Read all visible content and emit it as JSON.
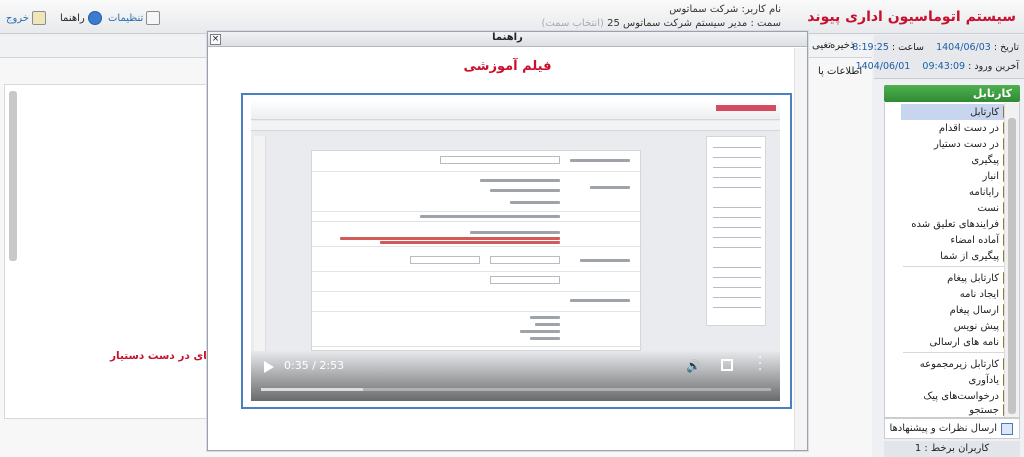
{
  "header": {
    "app_title": "سیستم اتوماسیون اداری پیوند",
    "user_name": "نام کاربر: شرکت سماتوس",
    "user_role": "سمت : مدیر سیستم شرکت سماتوس 25",
    "user_role_hint": "(انتخاب سمت)",
    "settings_label": "تنظیمات",
    "help_label": "راهنما",
    "exit_label": "خروج"
  },
  "dates": {
    "date_label": "تاریخ :",
    "date_value": "1404/06/03",
    "time_label": "ساعت :",
    "time_value": "8:19:25",
    "last_login_label": "آخرین ورود :",
    "last_login_time": "09:43:09",
    "last_login_date": "1404/06/01"
  },
  "toolbar": {
    "save_label": "ذخیره",
    "change_label": "تغیی"
  },
  "main": {
    "tab_info": "اطلاعات پا",
    "red_text": "د نامه های در دست دستیار"
  },
  "sidebar": {
    "header": "کارتابل",
    "items": [
      {
        "label": "کارتابل",
        "active": true
      },
      {
        "label": "در دست اقدام"
      },
      {
        "label": "در دست دستیار"
      },
      {
        "label": "پیگیری"
      },
      {
        "label": "انبار"
      },
      {
        "label": "رایانامه"
      },
      {
        "label": "نست"
      },
      {
        "label": "فرایندهای تعلیق شده"
      },
      {
        "label": "آماده امضاء"
      },
      {
        "label": "پیگیری از شما"
      },
      {
        "label": "کارتابل پیغام"
      },
      {
        "label": "ایجاد نامه"
      },
      {
        "label": "ارسال پیغام"
      },
      {
        "label": "پیش نویس"
      },
      {
        "label": "نامه های ارسالی"
      },
      {
        "label": "کارتابل زیرمجموعه"
      },
      {
        "label": "یادآوری"
      },
      {
        "label": "درخواست‌های پیک"
      },
      {
        "label": "جستجو"
      }
    ],
    "feedback_label": "ارسال نظرات و پیشنهادها",
    "online_label": "کاربران برخط : 1"
  },
  "modal": {
    "title": "راهنما",
    "subtitle": "فیلم آموزشی",
    "close_label": "×",
    "video": {
      "time": "0:35 / 2:53",
      "progress": 0.2
    }
  }
}
